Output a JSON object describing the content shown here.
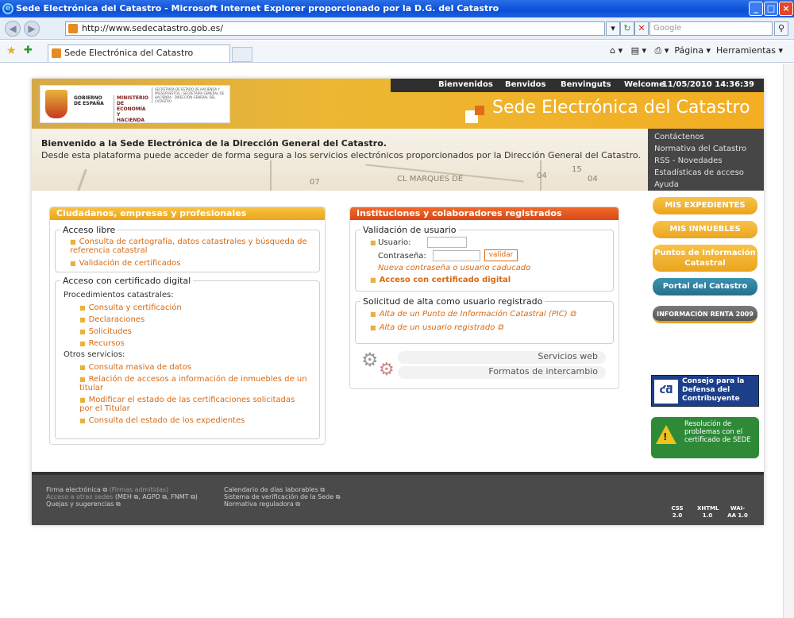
{
  "window": {
    "title": "Sede Electrónica del Catastro - Microsoft Internet Explorer proporcionado por la D.G. del Catastro"
  },
  "browser": {
    "url": "http://www.sedecatastro.gob.es/",
    "search_placeholder": "Google",
    "tab_title": "Sede Electrónica del Catastro",
    "tools": {
      "page": "Página",
      "tools": "Herramientas"
    }
  },
  "header": {
    "gov": "GOBIERNO DE ESPAÑA",
    "ministry": "MINISTERIO DE ECONOMÍA Y HACIENDA",
    "secretaria": "SECRETARÍA DE ESTADO DE HACIENDA Y PRESUPUESTOS · SECRETARÍA GENERAL DE HACIENDA · DIRECCIÓN GENERAL DEL CATASTRO",
    "langs": [
      "Bienvenidos",
      "Benvidos",
      "Benvinguts",
      "Welcome"
    ],
    "datetime": "11/05/2010 14:36:39",
    "site_title": "Sede Electrónica del Catastro"
  },
  "banner": {
    "welcome": "Bienvenido a la Sede Electrónica de la Dirección General del Catastro.",
    "intro": "Desde esta plataforma puede acceder de forma segura a los servicios electrónicos proporcionados por la Dirección General del Catastro.",
    "map_labels": [
      "CL MARQUES DE",
      "07",
      "04",
      "15",
      "04"
    ]
  },
  "quick_links": [
    "Contáctenos",
    "Normativa del Catastro",
    "RSS - Novedades",
    "Estadísticas de acceso",
    "Ayuda"
  ],
  "panel_left": {
    "title": "Ciudadanos, empresas y profesionales",
    "acceso_libre": "Acceso libre",
    "libre_links": [
      "Consulta de cartografía, datos catastrales y búsqueda de referencia catastral",
      "Validación de certificados"
    ],
    "acceso_cert": "Acceso con certificado digital",
    "proc_title": "Procedimientos catastrales:",
    "proc_links": [
      "Consulta y certificación",
      "Declaraciones",
      "Solicitudes",
      "Recursos"
    ],
    "otros_title": "Otros servicios:",
    "otros_links": [
      "Consulta masiva de datos",
      "Relación de accesos a información de inmuebles de un titular",
      "Modificar el estado de las certificaciones solicitadas por el Titular",
      "Consulta del estado de los expedientes"
    ]
  },
  "panel_center": {
    "title": "Instituciones y colaboradores registrados",
    "validacion": "Validación de usuario",
    "usuario": "Usuario:",
    "contrasena": "Contraseña:",
    "validar": "validar",
    "caducado": "Nueva contraseña o usuario caducado",
    "acceso_cert": "Acceso con certificado digital",
    "solicitud": "Solicitud de alta como usuario registrado",
    "alta_links": [
      "Alta de un Punto de Información Catastral (PIC)",
      "Alta de un usuario registrado"
    ],
    "servicios_web": "Servicios web",
    "formatos": "Formatos de intercambio"
  },
  "right_buttons": {
    "expedientes": "MIS EXPEDIENTES",
    "inmuebles": "MIS INMUEBLES",
    "puntos": "Puntos de Información Catastral",
    "portal": "Portal del Catastro",
    "renta": "INFORMACIÓN RENTA 2009",
    "consejo": "Consejo para la Defensa del Contribuyente",
    "resolucion": "Resolución de problemas con el certificado de SEDE"
  },
  "footer": {
    "col1": [
      "Firma electrónica",
      "(Firmas admitidas)",
      "Acceso a otras sedes",
      "MEH",
      "AGPD",
      "FNMT",
      "Quejas y sugerencias"
    ],
    "col2": [
      "Calendario de días laborables",
      "Sistema de verificación de la Sede",
      "Normativa reguladora"
    ],
    "badges": [
      "CSS 2.0",
      "XHTML 1.0",
      "WAI-AA 1.0"
    ]
  },
  "colors": {
    "orange": "#f3ae22",
    "red_header": "#e45a1c",
    "teal": "#2e7d98",
    "green": "#2f8a38"
  }
}
